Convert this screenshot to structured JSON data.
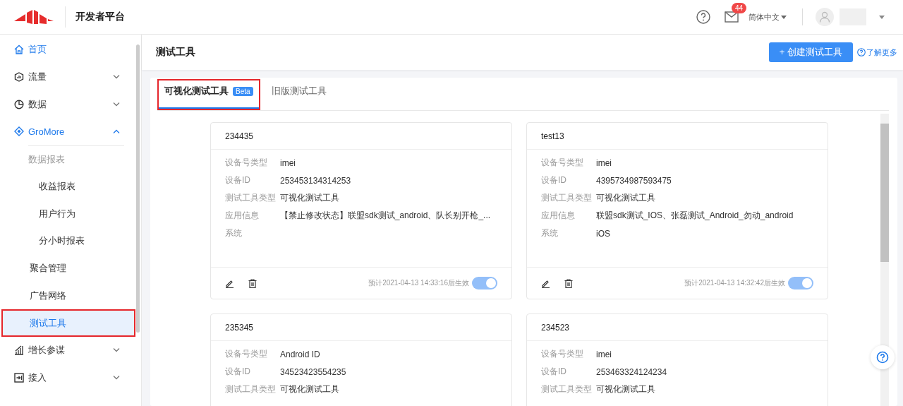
{
  "header": {
    "platform_title": "开发者平台",
    "notification_count": "44",
    "language": "简体中文"
  },
  "sidebar": {
    "items": [
      {
        "label": "首页",
        "active": true
      },
      {
        "label": "流量",
        "active": false,
        "expanded": false
      },
      {
        "label": "数据",
        "active": false,
        "expanded": false
      },
      {
        "label": "GroMore",
        "active": true,
        "expanded": true,
        "children": [
          {
            "label": "数据报表",
            "kind": "group",
            "children": [
              {
                "label": "收益报表",
                "selected": false
              },
              {
                "label": "用户行为",
                "selected": false
              },
              {
                "label": "分小时报表",
                "selected": false
              }
            ]
          },
          {
            "label": "聚合管理",
            "kind": "item",
            "selected": false,
            "highlighted": false
          },
          {
            "label": "广告网络",
            "kind": "item",
            "selected": false,
            "highlighted": false
          },
          {
            "label": "测试工具",
            "kind": "item",
            "selected": true,
            "highlighted": true
          }
        ]
      },
      {
        "label": "增长参谋",
        "active": false,
        "expanded": false
      },
      {
        "label": "接入",
        "active": false,
        "expanded": false
      }
    ]
  },
  "page": {
    "title": "测试工具",
    "create_button": "+ 创建测试工具",
    "learn_more": "了解更多"
  },
  "tabs": [
    {
      "label": "可视化测试工具",
      "badge": "Beta",
      "selected": true,
      "highlighted": true
    },
    {
      "label": "旧版测试工具",
      "selected": false,
      "highlighted": false
    }
  ],
  "cards": [
    {
      "name": "234435",
      "fields": [
        {
          "label": "设备号类型",
          "value": "imei"
        },
        {
          "label": "设备ID",
          "value": "253453134314253"
        },
        {
          "label": "测试工具类型",
          "value": "可视化测试工具"
        },
        {
          "label": "应用信息",
          "value": "【禁止修改状态】联盟sdk测试_android、队长别开枪_..."
        },
        {
          "label": "系统"
        }
      ],
      "footer": {
        "note": "预计2021-04-13 14:33:16后生效",
        "on": true
      }
    },
    {
      "name": "test13",
      "fields": [
        {
          "label": "设备号类型",
          "value": "imei"
        },
        {
          "label": "设备ID",
          "value": "4395734987593475"
        },
        {
          "label": "测试工具类型",
          "value": "可视化测试工具"
        },
        {
          "label": "应用信息",
          "value": "联盟sdk测试_IOS、张磊测试_Android_勿动_android"
        },
        {
          "label": "系统",
          "value": "iOS"
        }
      ],
      "footer": {
        "note": "预计2021-04-13 14:32:42后生效",
        "on": true
      }
    },
    {
      "name": "235345",
      "fields": [
        {
          "label": "设备号类型",
          "value": "Android ID"
        },
        {
          "label": "设备ID",
          "value": "34523423554235"
        },
        {
          "label": "测试工具类型",
          "value": "可视化测试工具"
        }
      ]
    },
    {
      "name": "234523",
      "fields": [
        {
          "label": "设备号类型",
          "value": "imei"
        },
        {
          "label": "设备ID",
          "value": "253463324124234"
        },
        {
          "label": "测试工具类型",
          "value": "可视化测试工具"
        }
      ]
    }
  ]
}
